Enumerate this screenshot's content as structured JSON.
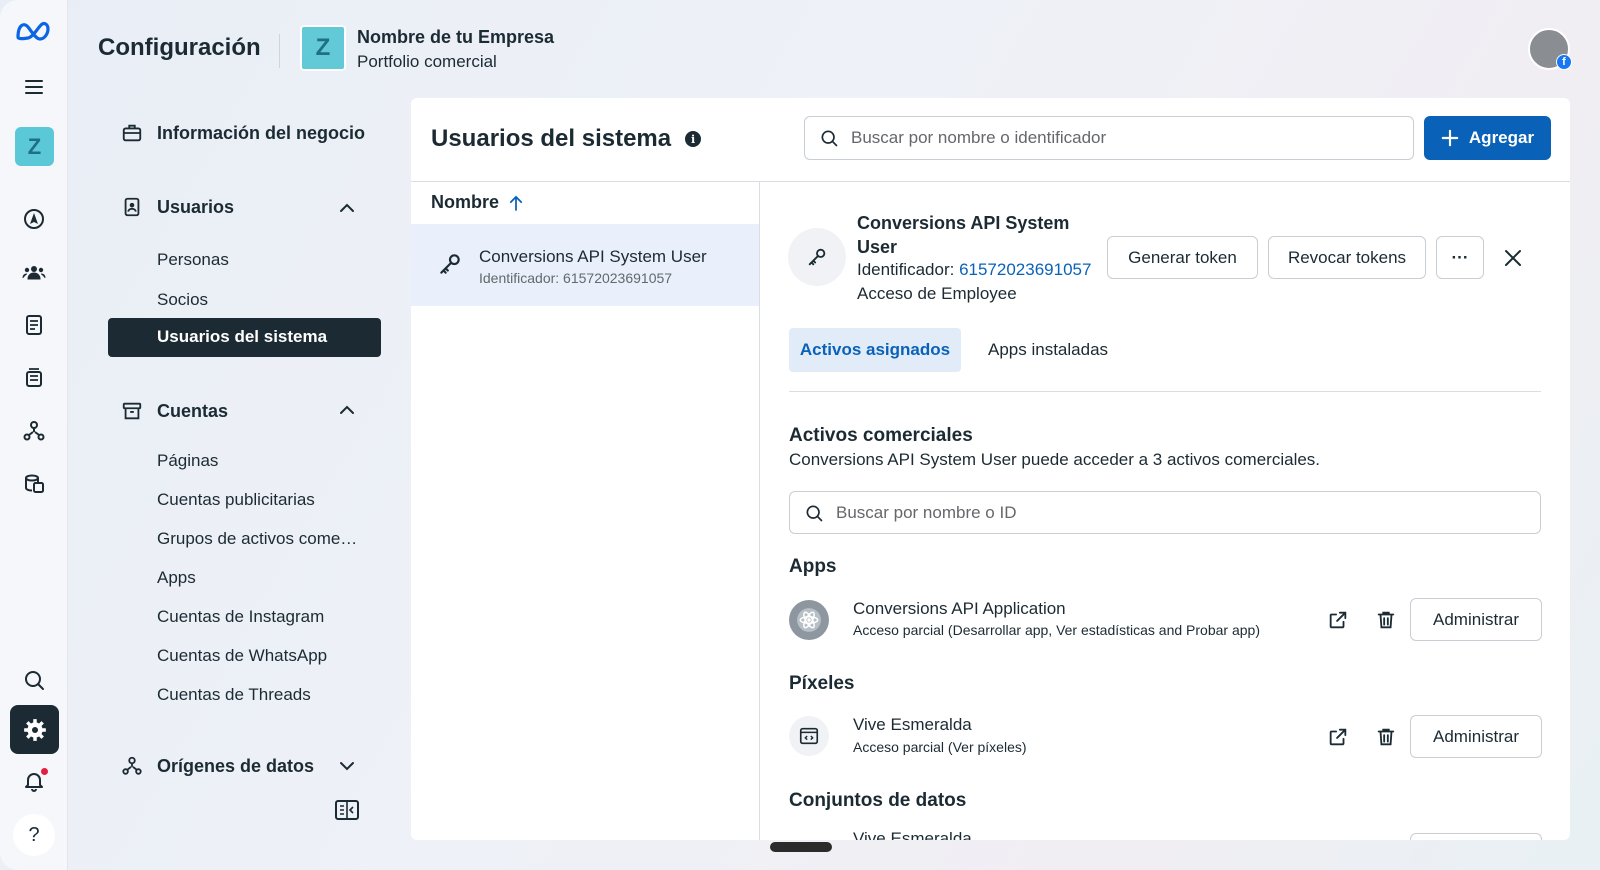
{
  "header": {
    "app_title": "Configuración",
    "business_initial": "Z",
    "business_name": "Nombre de tu Empresa",
    "business_subtitle": "Portfolio comercial",
    "profile_badge": "f"
  },
  "rail": {
    "workspace_initial": "Z",
    "help_label": "?",
    "icons": [
      "meta-logo-icon",
      "menu-icon",
      "compass-icon",
      "people-icon",
      "document-icon",
      "catalog-icon",
      "data-sources-icon",
      "billing-icon",
      "search-icon",
      "settings-icon",
      "bell-icon",
      "help-icon"
    ]
  },
  "sidebar": {
    "business_info": "Información del negocio",
    "users_section": "Usuarios",
    "users_items": [
      "Personas",
      "Socios",
      "Usuarios del sistema"
    ],
    "accounts_section": "Cuentas",
    "accounts_items": [
      "Páginas",
      "Cuentas publicitarias",
      "Grupos de activos come…",
      "Apps",
      "Cuentas de Instagram",
      "Cuentas de WhatsApp",
      "Cuentas de Threads"
    ],
    "data_sources_section": "Orígenes de datos"
  },
  "main": {
    "title": "Usuarios del sistema",
    "info_glyph": "i",
    "search_placeholder": "Buscar por nombre o identificador",
    "add_button": "Agregar",
    "list_header": "Nombre",
    "list_rows": [
      {
        "name": "Conversions API System User",
        "id": "Identificador: 61572023691057"
      }
    ]
  },
  "detail": {
    "name": "Conversions API System User",
    "id_label": "Identificador: ",
    "id_value": "61572023691057",
    "access": "Acceso de Employee",
    "generate_token": "Generar token",
    "revoke_tokens": "Revocar tokens",
    "more": "···",
    "tabs": [
      "Activos asignados",
      "Apps instaladas"
    ],
    "assets_title": "Activos comerciales",
    "assets_desc": "Conversions API System User puede acceder a 3 activos comerciales.",
    "assets_search_placeholder": "Buscar por nombre o ID",
    "apps_title": "Apps",
    "app_name": "Conversions API Application",
    "app_access": "Acceso parcial (Desarrollar app, Ver estadísticas and Probar app)",
    "pixels_title": "Píxeles",
    "pixel_name": "Vive Esmeralda",
    "pixel_access": "Acceso parcial (Ver píxeles)",
    "datasets_title": "Conjuntos de datos",
    "dataset_name_peek": "Vive Esmeralda",
    "manage_label": "Administrar"
  },
  "colors": {
    "accent": "#0a62b8",
    "dark": "#1c2b33",
    "business_tile": "#62c9d6",
    "selected_row": "#e9f0fb"
  }
}
